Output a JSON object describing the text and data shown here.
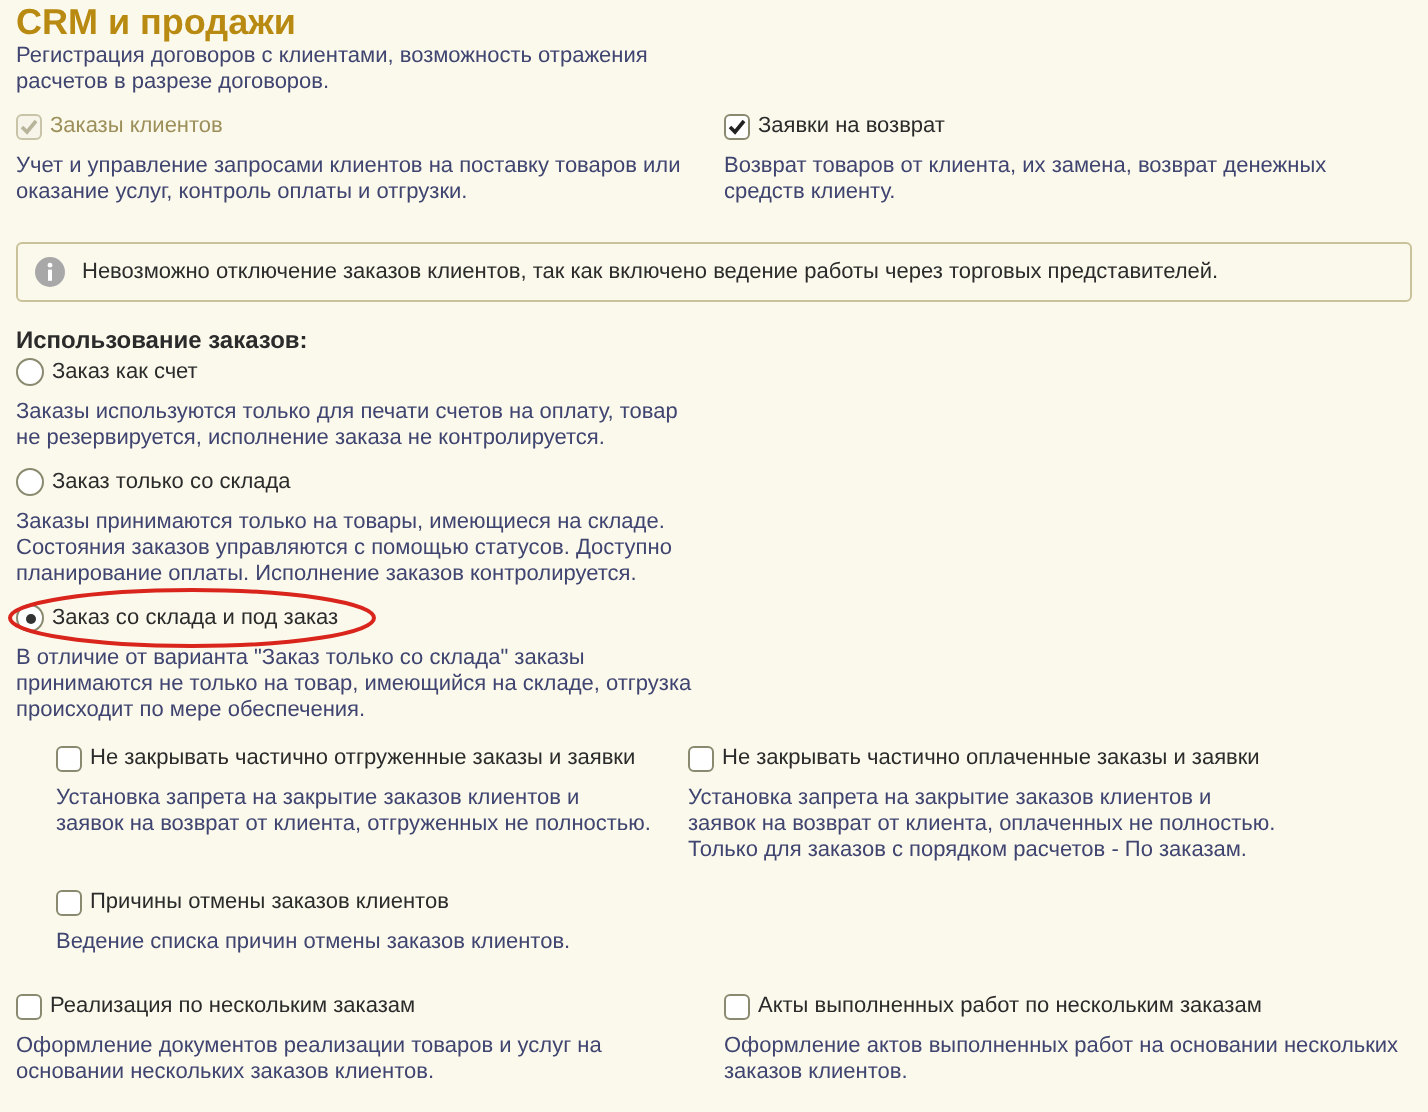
{
  "title": "CRM и продажи",
  "top_note": "Регистрация договоров с клиентами, возможность отражения\nрасчетов  в разрезе договоров.",
  "options_top": [
    {
      "label": "Заказы клиентов",
      "checked": true,
      "disabled": true,
      "description": "Учет и управление запросами клиентов на поставку товаров или\nоказание услуг, контроль оплаты и отгрузки."
    },
    {
      "label": "Заявки на возврат",
      "checked": true,
      "disabled": false,
      "description": "Возврат товаров от клиента, их замена, возврат денежных\nсредств клиенту."
    }
  ],
  "info_message": "Невозможно отключение заказов клиентов, так как включено ведение работы через торговых представителей.",
  "orders_usage": {
    "heading": "Использование заказов:",
    "options": [
      {
        "label": "Заказ как счет",
        "selected": false,
        "highlighted": false,
        "description": "Заказы используются  только для печати счетов на оплату, товар\nне резервируется, исполнение заказа не контролируется."
      },
      {
        "label": "Заказ только со склада",
        "selected": false,
        "highlighted": false,
        "description": "Заказы принимаются только на товары, имеющиеся на складе.\nСостояния заказов управляются с помощью статусов. Доступно\nпланирование оплаты. Исполнение заказов контролируется."
      },
      {
        "label": "Заказ со склада и под заказ",
        "selected": true,
        "highlighted": true,
        "description": "В отличие от варианта \"Заказ только со склада\" заказы\nпринимаются не только на товар, имеющийся на складе, отгрузка\nпроисходит по мере обеспечения."
      }
    ]
  },
  "sub_options": [
    {
      "label": "Не закрывать частично отгруженные заказы и заявки",
      "checked": false,
      "description": "Установка запрета на закрытие заказов клиентов и\nзаявок на возврат от клиента, отгруженных не полностью."
    },
    {
      "label": "Не закрывать частично оплаченные заказы и заявки",
      "checked": false,
      "description": "Установка запрета на закрытие заказов клиентов и\nзаявок на возврат от клиента, оплаченных не полностью.\nТолько для заказов с порядком расчетов - По заказам."
    },
    {
      "label": "Причины отмены заказов клиентов",
      "checked": false,
      "description": "Ведение списка причин отмены заказов клиентов."
    }
  ],
  "bottom_options": [
    {
      "label": "Реализация по нескольким заказам",
      "checked": false,
      "disabled": false,
      "description": "Оформление документов реализации товаров и услуг на\nосновании нескольких заказов клиентов."
    },
    {
      "label": "Акты выполненных работ по нескольким заказам",
      "checked": false,
      "disabled": false,
      "description": "Оформление актов выполненных работ на основании нескольких\nзаказов клиентов."
    }
  ]
}
